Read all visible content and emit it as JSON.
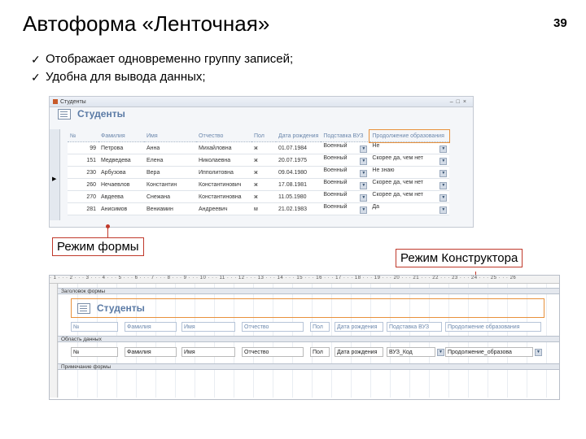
{
  "slide": {
    "title": "Автоформа «Ленточная»",
    "page_number": "39",
    "bullets": [
      "Отображает одновременно группу записей;",
      "Удобна для вывода данных;"
    ]
  },
  "form_view": {
    "tab_label": "Студенты",
    "title": "Студенты",
    "columns": [
      "№",
      "Фамилия",
      "Имя",
      "Отчество",
      "Пол",
      "Дата рождения",
      "Подставка ВУЗ",
      "Продолжение образования"
    ],
    "rows": [
      [
        "99",
        "Петрова",
        "Анна",
        "Михайловна",
        "ж",
        "01.07.1984",
        "Военный",
        "Не"
      ],
      [
        "151",
        "Медведева",
        "Елена",
        "Николаевна",
        "ж",
        "20.07.1975",
        "Военный",
        "Скорее да, чем нет"
      ],
      [
        "230",
        "Арбузова",
        "Вера",
        "Ипполитовна",
        "ж",
        "09.04.1980",
        "Военный",
        "Не знаю"
      ],
      [
        "260",
        "Нечаевлов",
        "Константин",
        "Константинович",
        "ж",
        "17.08.1981",
        "Военный",
        "Скорее да, чем нет"
      ],
      [
        "270",
        "Авдеева",
        "Снежана",
        "Константиновна",
        "ж",
        "11.05.1980",
        "Военный",
        "Скорее да, чем нет"
      ],
      [
        "281",
        "Анисимов",
        "Вениамин",
        "Андреевич",
        "м",
        "21.02.1983",
        "Военный",
        "Да"
      ]
    ]
  },
  "callouts": {
    "form_mode": "Режим формы",
    "design_mode": "Режим Конструктора"
  },
  "design_view": {
    "ruler_text": "· 1 · · · 2 · · · 3 · · · 4 · · · 5 · · · 6 · · · 7 · · · 8 · · · 9 · · · 10 · · · 11 · · · 12 · · · 13 · · · 14 · · · 15 · · · 16 · · · 17 · · · 18 · · · 19 · · · 20 · · · 21 · · · 22 · · · 23 · · · 24 · · · 25 · · · 26",
    "header_section": "Заголовок формы",
    "title": "Студенты",
    "labels": [
      "№",
      "Фамилия",
      "Имя",
      "Отчество",
      "Пол",
      "Дата рождения",
      "Подставка ВУЗ",
      "Продолжение образования"
    ],
    "data_section": "Область данных",
    "fields": [
      "№",
      "Фамилия",
      "Имя",
      "Отчество",
      "Пол",
      "Дата рождения",
      "ВУЗ_Код",
      "Продолжение_образова"
    ],
    "footer_section": "Примечание формы"
  },
  "colors": {
    "accent_orange": "#e8913b",
    "callout_red": "#c0392b",
    "access_title_blue": "#5a7aa5"
  }
}
